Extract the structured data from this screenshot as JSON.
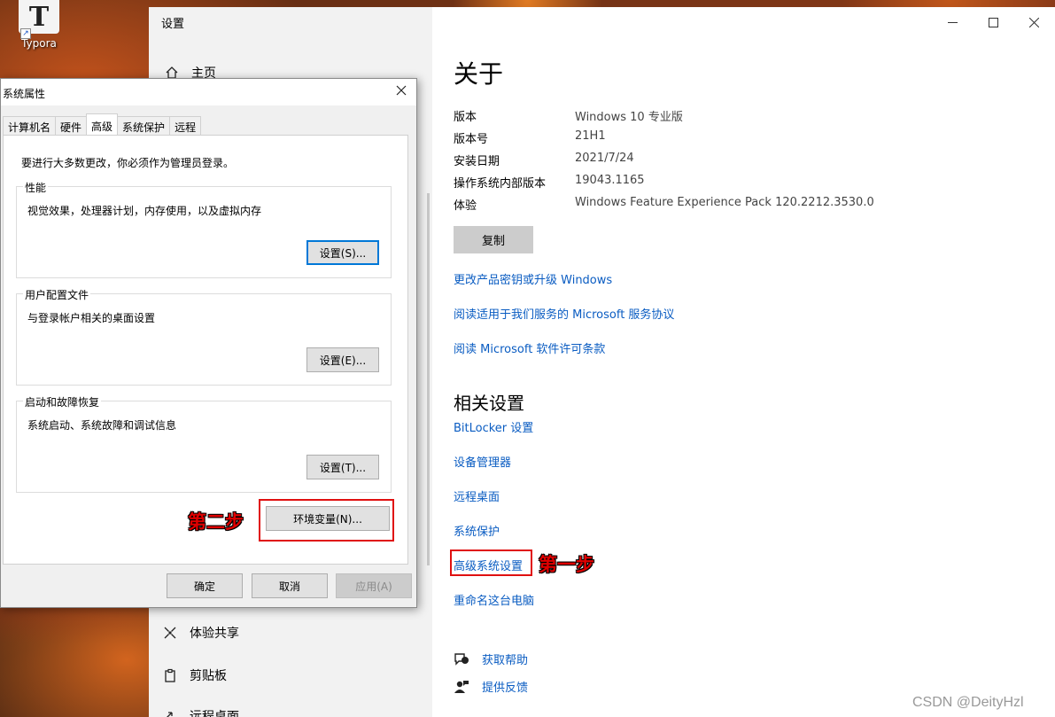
{
  "desktop": {
    "icon_label": "Typora",
    "icon_letter": "T"
  },
  "settings": {
    "window_title": "设置",
    "home_label": "主页",
    "nav_items": [
      {
        "label": "体验共享",
        "icon": "share-icon"
      },
      {
        "label": "剪贴板",
        "icon": "clipboard-icon"
      },
      {
        "label": "远程桌面",
        "icon": "remote-desktop-icon"
      }
    ],
    "about": {
      "heading": "关于",
      "specs": [
        {
          "key": "版本",
          "value": "Windows 10 专业版"
        },
        {
          "key": "版本号",
          "value": "21H1"
        },
        {
          "key": "安装日期",
          "value": "2021/7/24"
        },
        {
          "key": "操作系统内部版本",
          "value": "19043.1165"
        },
        {
          "key": "体验",
          "value": "Windows Feature Experience Pack 120.2212.3530.0"
        }
      ],
      "copy_button": "复制",
      "links": [
        "更改产品密钥或升级 Windows",
        "阅读适用于我们服务的 Microsoft 服务协议",
        "阅读 Microsoft 软件许可条款"
      ]
    },
    "related": {
      "heading": "相关设置",
      "links": [
        "BitLocker 设置",
        "设备管理器",
        "远程桌面",
        "系统保护",
        "高级系统设置",
        "重命名这台电脑"
      ]
    },
    "help": {
      "get_help": "获取帮助",
      "feedback": "提供反馈"
    }
  },
  "dialog": {
    "title": "系统属性",
    "tabs": [
      "计算机名",
      "硬件",
      "高级",
      "系统保护",
      "远程"
    ],
    "active_tab": "高级",
    "note": "要进行大多数更改，你必须作为管理员登录。",
    "groups": [
      {
        "title": "性能",
        "desc": "视觉效果，处理器计划，内存使用，以及虚拟内存",
        "button": "设置(S)..."
      },
      {
        "title": "用户配置文件",
        "desc": "与登录帐户相关的桌面设置",
        "button": "设置(E)..."
      },
      {
        "title": "启动和故障恢复",
        "desc": "系统启动、系统故障和调试信息",
        "button": "设置(T)..."
      }
    ],
    "env_button": "环境变量(N)...",
    "ok_button": "确定",
    "cancel_button": "取消",
    "apply_button": "应用(A)"
  },
  "annotations": {
    "step_one": "第一步",
    "step_two": "第二步",
    "highlight_color": "#e01010"
  },
  "watermark": "CSDN @DeityHzl"
}
